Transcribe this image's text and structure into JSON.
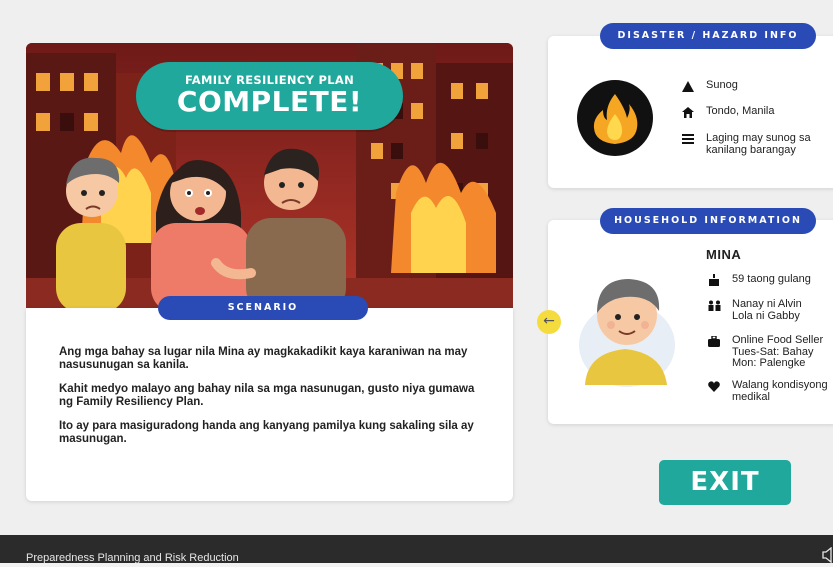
{
  "scene": {
    "subtitle": "FAMILY RESILIENCY PLAN",
    "headline": "COMPLETE!"
  },
  "scenario": {
    "label": "SCENARIO",
    "paragraphs": [
      "Ang mga bahay sa lugar nila Mina ay magkakadikit kaya karaniwan na may nasusunugan sa kanila.",
      "Kahit medyo malayo ang bahay nila sa mga nasunugan, gusto niya gumawa ng Family Resiliency Plan.",
      "Ito ay para masiguradong handa ang kanyang pamilya kung sakaling sila ay masunugan."
    ]
  },
  "hazard": {
    "header": "DISASTER / HAZARD INFO",
    "icon": "fire-icon",
    "items": [
      {
        "icon": "warning-icon",
        "text": "Sunog"
      },
      {
        "icon": "home-icon",
        "text": "Tondo, Manila"
      },
      {
        "icon": "list-icon",
        "text": "Laging may sunog sa kanilang barangay"
      }
    ]
  },
  "household": {
    "header": "HOUSEHOLD INFORMATION",
    "name": "MINA",
    "items": [
      {
        "icon": "cake-icon",
        "text": "59 taong gulang"
      },
      {
        "icon": "family-icon",
        "text": "Nanay ni Alvin Lola ni Gabby"
      },
      {
        "icon": "briefcase-icon",
        "text": "Online Food Seller Tues-Sat: Bahay Mon: Palengke"
      },
      {
        "icon": "heart-icon",
        "text": "Walang kondisyong medikal"
      }
    ]
  },
  "nav": {
    "back_arrow": "←",
    "exit_label": "EXIT"
  },
  "footer": {
    "title": "Preparedness Planning and Risk Reduction"
  },
  "colors": {
    "teal": "#1fa89b",
    "blue": "#2a4bb5",
    "yellow": "#f4dc3f",
    "footer": "#2b2b2b"
  }
}
